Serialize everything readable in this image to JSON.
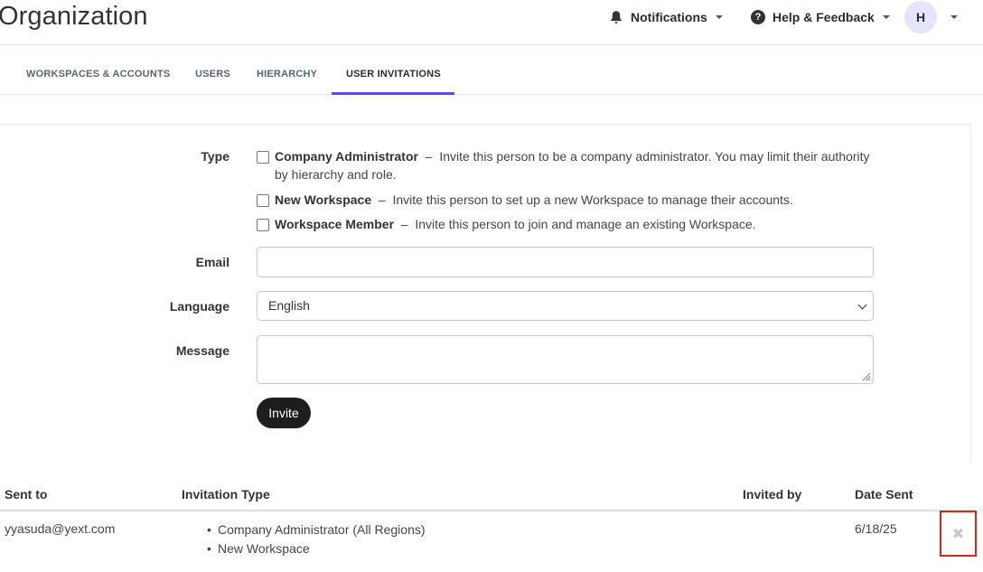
{
  "header": {
    "title": "Organization",
    "notifications_label": "Notifications",
    "help_label": "Help & Feedback",
    "help_icon_glyph": "?",
    "avatar_initial": "H"
  },
  "tabs": [
    {
      "label": "WORKSPACES & ACCOUNTS",
      "active": false
    },
    {
      "label": "USERS",
      "active": false
    },
    {
      "label": "HIERARCHY",
      "active": false
    },
    {
      "label": "USER INVITATIONS",
      "active": true
    }
  ],
  "form": {
    "type_label": "Type",
    "options": [
      {
        "title": "Company Administrator",
        "description": "Invite this person to be a company administrator. You may limit their authority by hierarchy and role.",
        "checked": false
      },
      {
        "title": "New Workspace",
        "description": "Invite this person to set up a new Workspace to manage their accounts.",
        "checked": false
      },
      {
        "title": "Workspace Member",
        "description": "Invite this person to join and manage an existing Workspace.",
        "checked": false
      }
    ],
    "separator": "–",
    "email_label": "Email",
    "email_value": "",
    "language_label": "Language",
    "language_value": "English",
    "message_label": "Message",
    "message_value": "",
    "invite_button": "Invite"
  },
  "table": {
    "columns": [
      "Sent to",
      "Invitation Type",
      "Invited by",
      "Date Sent"
    ],
    "rows": [
      {
        "sent_to": "yyasuda@yext.com",
        "invitation_types": [
          "Company Administrator (All Regions)",
          "New Workspace"
        ],
        "invited_by": "",
        "date_sent": "6/18/25",
        "delete_glyph": "✖"
      }
    ]
  },
  "colors": {
    "accent": "#5a4ed1",
    "avatar_bg": "#e6e4fb",
    "highlight_border": "#d9261c",
    "button_bg": "#1e1e1e"
  }
}
